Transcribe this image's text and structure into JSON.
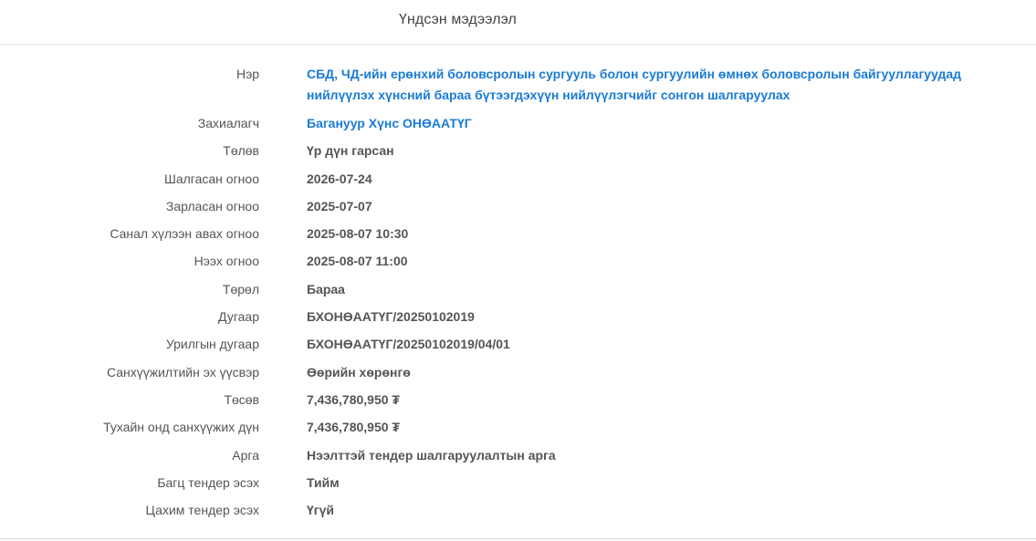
{
  "header": {
    "title": "Үндсэн мэдээлэл"
  },
  "details": [
    {
      "label": "Нэр",
      "value": "СБД, ЧД-ийн ерөнхий боловсролын сургууль болон сургуулийн өмнөх боловсролын байгууллагуудад нийлүүлэх хүнсний бараа бүтээгдэхүүн нийлүүлэгчийг сонгон шалгаруулах"
    },
    {
      "label": "Захиалагч",
      "value": "Багануур Хүнс ОНӨААТҮГ"
    },
    {
      "label": "Төлөв",
      "value": "Үр дүн гарсан"
    },
    {
      "label": "Шалгасан огноо",
      "value": "2026-07-24"
    },
    {
      "label": "Зарласан огноо",
      "value": "2025-07-07"
    },
    {
      "label": "Санал хүлээн авах огноо",
      "value": "2025-08-07 10:30"
    },
    {
      "label": "Нээх огноо",
      "value": "2025-08-07 11:00"
    },
    {
      "label": "Төрөл",
      "value": "Бараа"
    },
    {
      "label": "Дугаар",
      "value": "БХОНӨААТҮГ/20250102019"
    },
    {
      "label": "Урилгын дугаар",
      "value": "БХОНӨААТҮГ/20250102019/04/01"
    },
    {
      "label": "Санхүүжилтийн эх үүсвэр",
      "value": "Өөрийн хөрөнгө"
    },
    {
      "label": "Төсөв",
      "value": "7,436,780,950 ₮"
    },
    {
      "label": "Тухайн онд санхүүжих дүн",
      "value": "7,436,780,950 ₮"
    },
    {
      "label": "Арга",
      "value": "Нээлттэй тендер шалгаруулалтын арга"
    },
    {
      "label": "Багц тендер эсэх",
      "value": "Тийм"
    },
    {
      "label": "Цахим тендер эсэх",
      "value": "Үгүй"
    }
  ],
  "colors": {
    "link": "#1a7bd6",
    "text": "#555555"
  }
}
